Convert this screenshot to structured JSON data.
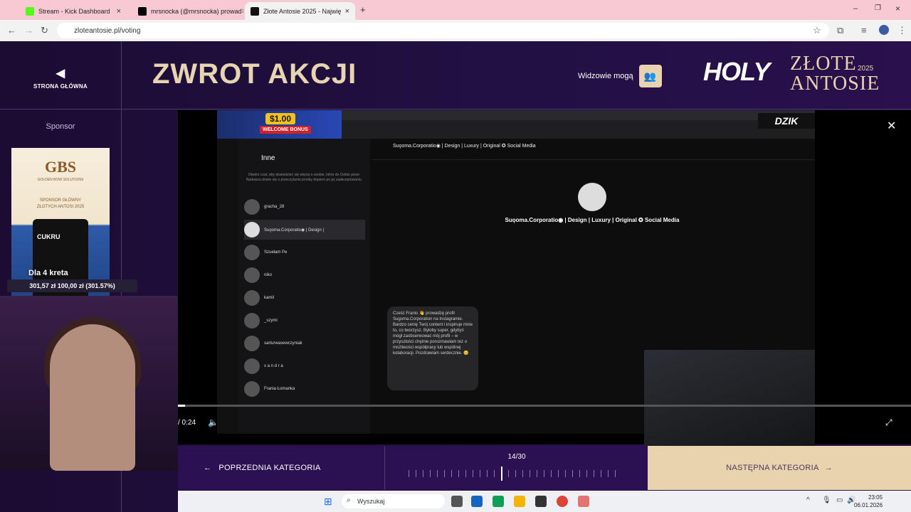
{
  "browser": {
    "tabs": [
      {
        "title": "Stream - Kick Dashboard",
        "favicon_color": "#53fc18",
        "active": false
      },
      {
        "title": "mrsnocka (@mrsnocka) prowad",
        "favicon_color": "#000000",
        "active": false
      },
      {
        "title": "Złote Antosie 2025 - Najwię",
        "favicon_color": "#111111",
        "active": true
      }
    ],
    "url": "zloteantosie.pl/voting"
  },
  "site": {
    "home_label": "STRONA GŁÓWNA",
    "category_title": "ZWROT AKCJI",
    "viewers_label": "Widzowie mogą",
    "logo_holy": "HOLY",
    "logo_zlote": "ZŁOTE",
    "logo_antosie": "ANTOSIE",
    "logo_year": "2025",
    "sponsor_label": "Sponsor",
    "ad": {
      "brand": "GBS",
      "brand_sub": "GOLDEN BOW SOLUTIONS",
      "line1": "SPONSOR GŁÓWNY",
      "line2": "ZŁOTYCH ANTOSI 2025",
      "can_label": "CUKRU"
    }
  },
  "player": {
    "time": "/ 0:24",
    "progress": 0.01,
    "stream": {
      "bonus_amount": "$1.00",
      "bonus_text": "WELCOME BONUS",
      "dzik_label": "DZIK",
      "ig_list_title": "Inne",
      "ig_info": "Otwórz czat, aby dowiedzieć się więcej o osobie, która do Ciebie pisze. Nadawca dowie się o przeczytaniu prośby dopiero po jej zaakceptowaniu.",
      "ig_rows": [
        "gracha_28",
        "Suǫoma.Corporatio◉ | Design |",
        "Szuełam Pe",
        "niko",
        "kamil",
        "_szymi",
        "sarturwasewczyniak",
        "s a n d r a",
        "Frania Łomanka"
      ],
      "chat_title": "Suǫoma.Corporatio◉ | Design | Luxury | Original ✪ Social Media",
      "chat_name": "Suǫoma.Corporatio◉ | Design | Luxury | Original ✪ Social Media",
      "bubble": "Cześć Franio 👋 prowadzę profil Sugoma.Corporation na Instagramie. Bardzo cenię Twój content i inspiruje mnie to, co tworzysz. Byłoby super, gdybyś mógł zaobserwować mój profil – w przyszłości chętnie porozmawiam też o możliwości współpracy lub wspólnej kolaboracji. Pozdrawiam serdecznie. 😊"
    }
  },
  "navigation": {
    "prev_label": "POPRZEDNIA KATEGORIA",
    "next_label": "NASTĘPNA KATEGORIA",
    "counter": "14/30",
    "current": 14,
    "total": 30
  },
  "overlay": {
    "donation_text": "Dla 4 kreta",
    "goal_text": "301,57 zł   100,00 zł (301.57%)"
  },
  "taskbar": {
    "search_placeholder": "Wyszukaj",
    "time": "23:05",
    "date": "06.01.2026"
  }
}
